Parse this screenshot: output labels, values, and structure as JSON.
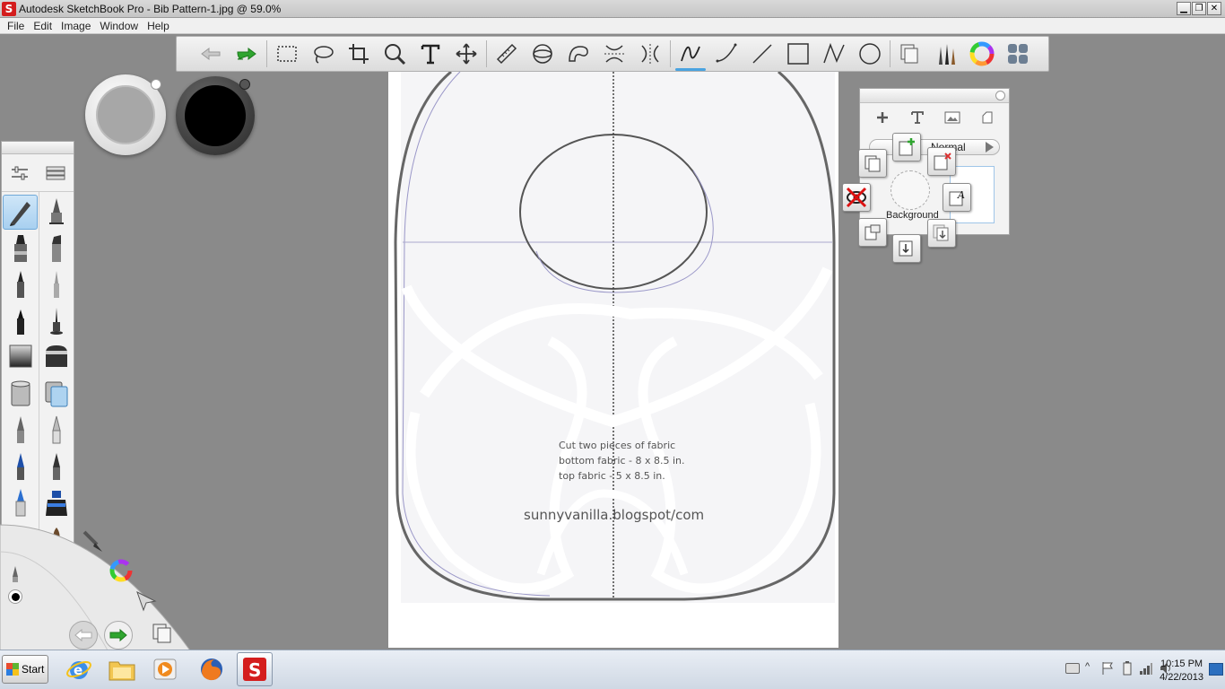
{
  "window": {
    "title": "Autodesk SketchBook Pro - Bib Pattern-1.jpg @ 59.0%",
    "app_icon_letter": "S",
    "controls": [
      "minimize",
      "restore",
      "close"
    ]
  },
  "menu": {
    "items": [
      "File",
      "Edit",
      "Image",
      "Window",
      "Help"
    ]
  },
  "toolbar": {
    "tools": [
      "undo-icon",
      "redo-icon",
      "rect-select-icon",
      "lasso-icon",
      "crop-icon",
      "zoom-icon",
      "text-icon",
      "move-icon",
      "ruler-icon",
      "ellipse-guide-icon",
      "french-curve-icon",
      "symmetry-x-icon",
      "symmetry-y-icon",
      "stroke-line-icon",
      "curve-icon",
      "line-icon",
      "rectangle-icon",
      "polyline-icon",
      "circle-icon",
      "layers-icon",
      "brushes-icon",
      "color-wheel-icon",
      "palettes-icon"
    ],
    "active_tool": "stroke-line-icon"
  },
  "colors": {
    "primary": "#000000",
    "secondary": "#a7a7a7",
    "accent": "#4aa3e0"
  },
  "canvas": {
    "note_lines": [
      "Cut two pieces of fabric",
      "bottom fabric - 8 x 8.5 in.",
      "top fabric - 5 x 8.5 in."
    ],
    "credit": "sunnyvanilla.blogspot/com"
  },
  "layer_editor": {
    "tools": [
      "add-layer-icon",
      "text-layer-icon",
      "image-layer-icon",
      "clear-layer-icon"
    ],
    "blend_mode": "Normal",
    "layer_name": "Background"
  },
  "taskbar": {
    "start_label": "Start",
    "apps": [
      "internet-explorer-icon",
      "file-explorer-icon",
      "media-player-icon",
      "firefox-icon",
      "sketchbook-icon"
    ],
    "time": "10:15 PM",
    "date": "4/22/2013"
  }
}
